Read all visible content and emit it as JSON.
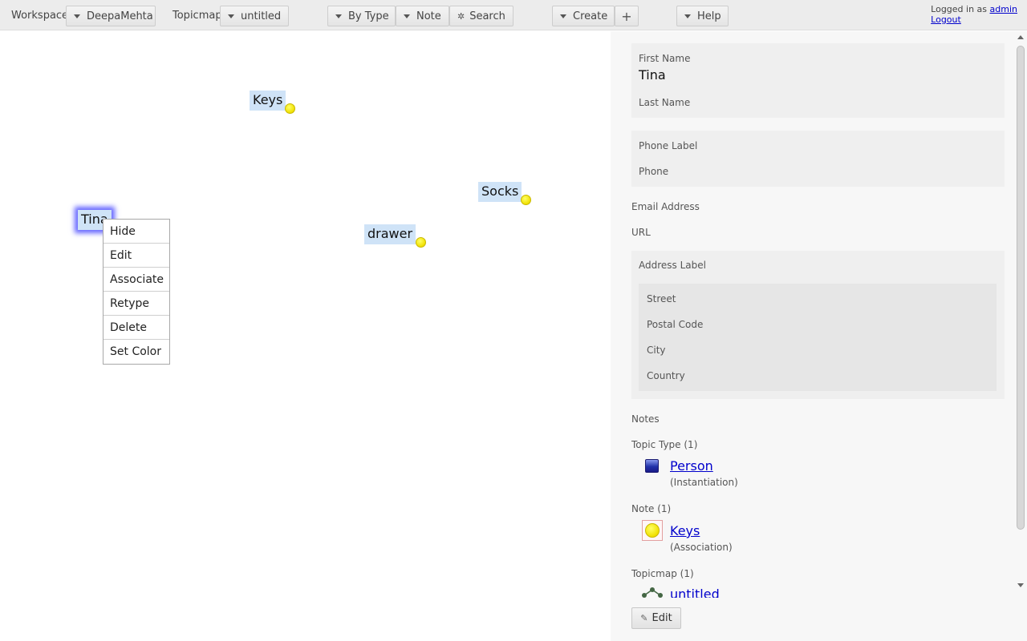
{
  "toolbar": {
    "workspace_label": "Workspace",
    "workspace_value": "DeepaMehta",
    "topicmap_label": "Topicmap",
    "topicmap_value": "untitled",
    "by_type": "By Type",
    "note": "Note",
    "search": "Search",
    "create": "Create",
    "plus": "+",
    "help": "Help",
    "logged_in_text": "Logged in as",
    "username": "admin",
    "logout": "Logout"
  },
  "canvas": {
    "topics": [
      {
        "label": "Keys"
      },
      {
        "label": "Socks"
      },
      {
        "label": "Tina",
        "selected": true
      },
      {
        "label": "drawer"
      }
    ],
    "context_menu": [
      "Hide",
      "Edit",
      "Associate",
      "Retype",
      "Delete",
      "Set Color"
    ]
  },
  "detail": {
    "first_name_label": "First Name",
    "first_name_value": "Tina",
    "last_name_label": "Last Name",
    "phone_label_label": "Phone Label",
    "phone_label": "Phone",
    "email_label": "Email Address",
    "url_label": "URL",
    "address_label": "Address Label",
    "street_label": "Street",
    "postal_code_label": "Postal Code",
    "city_label": "City",
    "country_label": "Country",
    "notes_label": "Notes",
    "topic_type_header": "Topic Type (1)",
    "topic_type_link": "Person",
    "topic_type_sub": "(Instantiation)",
    "note_header": "Note (1)",
    "note_link": "Keys",
    "note_sub": "(Association)",
    "topicmap_header": "Topicmap (1)",
    "topicmap_link": "untitled",
    "edit_button": "Edit"
  },
  "colors": {
    "topic_bg": "#cfe3f7",
    "selection_glow": "#6666ff",
    "link": "#0000cc",
    "note_dot": "#f0e000",
    "person_icon": "#2233aa"
  }
}
